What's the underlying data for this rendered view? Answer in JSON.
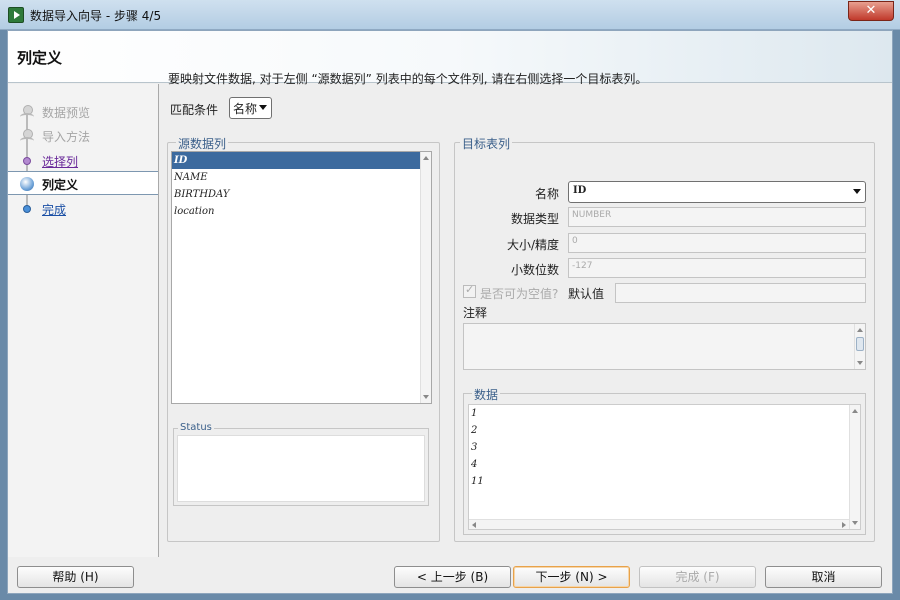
{
  "window": {
    "title": "数据导入向导 - 步骤 4/5",
    "close_label": "✕"
  },
  "header": {
    "title": "列定义"
  },
  "nav": {
    "items": [
      {
        "label": "数据预览",
        "state": "done"
      },
      {
        "label": "导入方法",
        "state": "done"
      },
      {
        "label": "选择列",
        "state": "visited"
      },
      {
        "label": "列定义",
        "state": "active"
      },
      {
        "label": "完成",
        "state": "link"
      }
    ]
  },
  "main": {
    "instruction": "要映射文件数据, 对于左侧 “源数据列” 列表中的每个文件列, 请在右侧选择一个目标表列。",
    "match_label": "匹配条件",
    "match_value": "名称"
  },
  "source": {
    "legend": "源数据列",
    "columns": [
      "ID",
      "NAME",
      "BIRTHDAY",
      "location"
    ],
    "selected_index": 0,
    "status_legend": "Status"
  },
  "target": {
    "legend": "目标表列",
    "name_label": "名称",
    "name_value": "ID",
    "type_label": "数据类型",
    "type_value": "NUMBER",
    "size_label": "大小/精度",
    "size_value": "0",
    "scale_label": "小数位数",
    "scale_value": "-127",
    "nullable_label": "是否可为空值?",
    "default_label": "默认值",
    "comment_label": "注释",
    "data_legend": "数据",
    "data_rows": [
      "1",
      "2",
      "3",
      "4",
      "11"
    ]
  },
  "buttons": {
    "help": "帮助 (H)",
    "back": "< 上一步 (B)",
    "next": "下一步 (N) >",
    "finish": "完成 (F)",
    "cancel": "取消"
  }
}
